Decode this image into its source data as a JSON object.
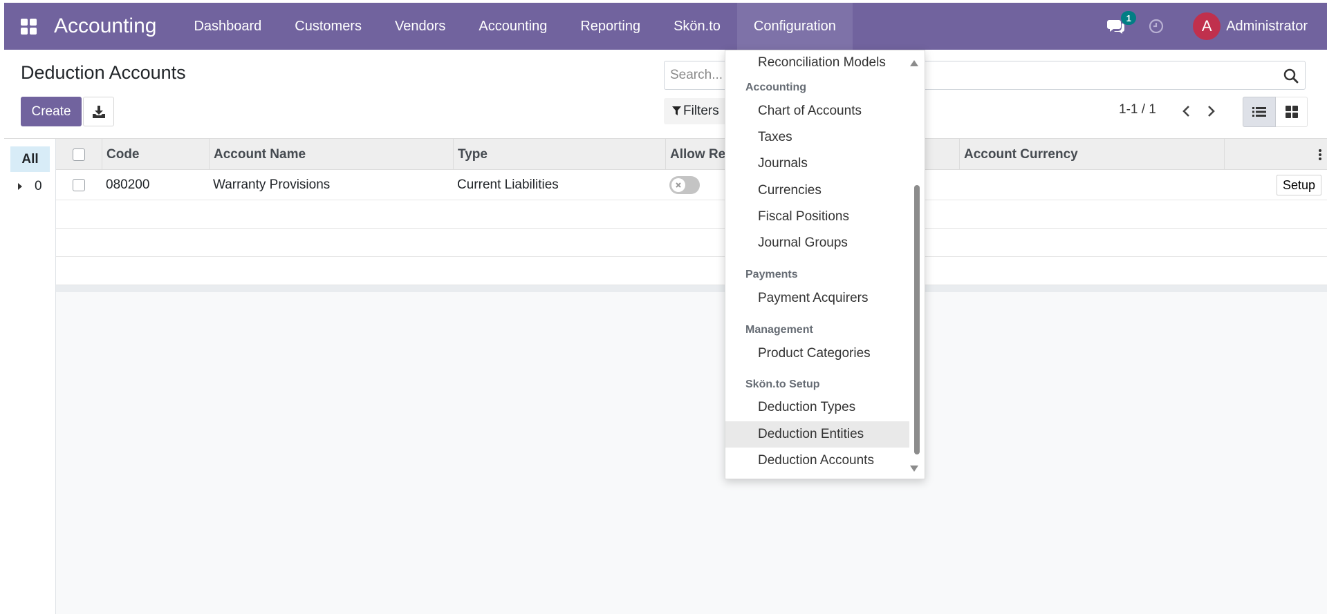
{
  "navbar": {
    "brand": "Accounting",
    "menu": [
      "Dashboard",
      "Customers",
      "Vendors",
      "Accounting",
      "Reporting",
      "Skön.to",
      "Configuration"
    ],
    "active_menu": "Configuration",
    "chat_badge": "1",
    "avatar_letter": "A",
    "user_name": "Administrator"
  },
  "control_panel": {
    "title": "Deduction Accounts",
    "create_label": "Create",
    "search_placeholder": "Search...",
    "filters_label": "Filters",
    "pager": "1-1 / 1"
  },
  "group_panel": {
    "all_label": "All",
    "group_count": "0"
  },
  "list": {
    "columns": [
      "Code",
      "Account Name",
      "Type",
      "Allow Rec",
      "Account Currency"
    ],
    "rows": [
      {
        "code": "080200",
        "account_name": "Warranty Provisions",
        "type": "Current Liabilities",
        "allow_reconciliation": false,
        "setup_label": "Setup"
      }
    ]
  },
  "dropdown": {
    "items_top": [
      "Reconciliation Models"
    ],
    "sections": [
      {
        "header": "Accounting",
        "items": [
          "Chart of Accounts",
          "Taxes",
          "Journals",
          "Currencies",
          "Fiscal Positions",
          "Journal Groups"
        ]
      },
      {
        "header": "Payments",
        "items": [
          "Payment Acquirers"
        ]
      },
      {
        "header": "Management",
        "items": [
          "Product Categories"
        ]
      },
      {
        "header": "Skön.to Setup",
        "items": [
          "Deduction Types",
          "Deduction Entities",
          "Deduction Accounts"
        ]
      }
    ],
    "hovered_item": "Deduction Entities"
  },
  "colors": {
    "navbar": "#71639e",
    "primary": "#71639e",
    "avatar": "#c0304d",
    "chat_badge": "#017e84"
  }
}
